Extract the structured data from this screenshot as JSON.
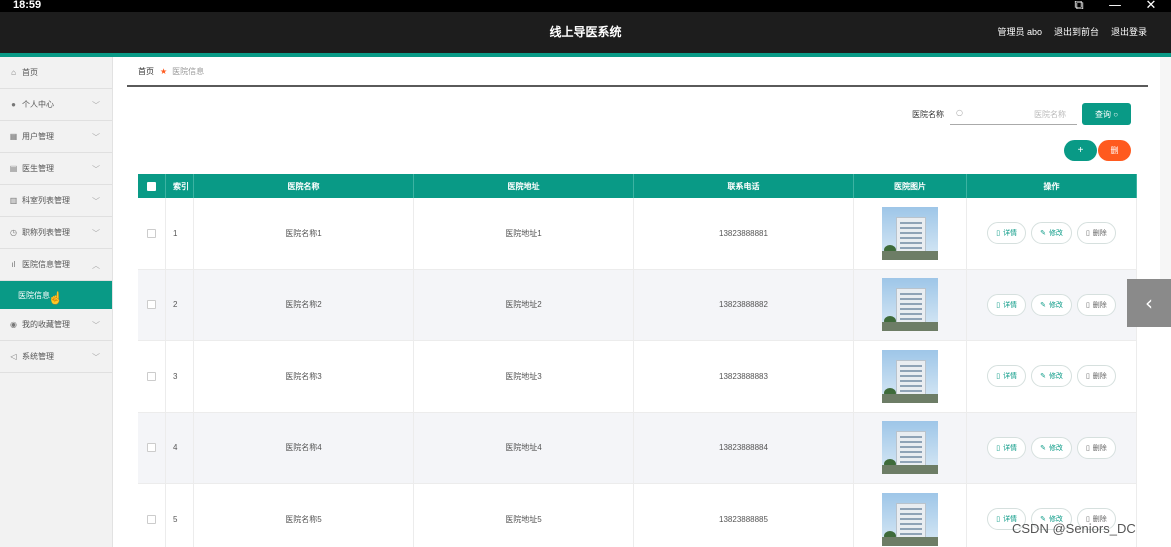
{
  "os": {
    "time": "18:59",
    "controls": [
      "⧉",
      "—",
      "✕"
    ]
  },
  "header": {
    "title": "线上导医系统",
    "admin": "管理员 abo",
    "back_front": "退出到前台",
    "logout": "退出登录"
  },
  "sidebar": {
    "items": [
      {
        "icon": "home-icon",
        "glyph": "⌂",
        "label": "首页",
        "chevron": false
      },
      {
        "icon": "user-icon",
        "glyph": "●",
        "label": "个人中心",
        "chevron": true
      },
      {
        "icon": "grid-icon",
        "glyph": "▦",
        "label": "用户管理",
        "chevron": true
      },
      {
        "icon": "building-icon",
        "glyph": "▤",
        "label": "医生管理",
        "chevron": true
      },
      {
        "icon": "bar-icon",
        "glyph": "▥",
        "label": "科室列表管理",
        "chevron": true
      },
      {
        "icon": "clock-icon",
        "glyph": "◷",
        "label": "职称列表管理",
        "chevron": true
      },
      {
        "icon": "chart-icon",
        "glyph": "ıl",
        "label": "医院信息管理",
        "chevron": true,
        "expanded": true
      }
    ],
    "sub_item": "医院信息",
    "items_after": [
      {
        "icon": "pin-icon",
        "glyph": "◉",
        "label": "我的收藏管理",
        "chevron": true
      },
      {
        "icon": "send-icon",
        "glyph": "◁",
        "label": "系统管理",
        "chevron": true
      }
    ]
  },
  "breadcrumb": {
    "home": "首页",
    "current": "医院信息"
  },
  "search": {
    "label": "医院名称",
    "placeholder": "医院名称",
    "button": "查询 ○"
  },
  "actions": {
    "add": "+",
    "delete": "删"
  },
  "table": {
    "headers": {
      "index": "索引",
      "name": "医院名称",
      "address": "医院地址",
      "phone": "联系电话",
      "picture": "医院图片",
      "ops": "操作"
    },
    "op_labels": {
      "detail": "详情",
      "edit": "修改",
      "delete": "删除"
    },
    "rows": [
      {
        "index": "1",
        "name": "医院名称1",
        "address": "医院地址1",
        "phone": "13823888881"
      },
      {
        "index": "2",
        "name": "医院名称2",
        "address": "医院地址2",
        "phone": "13823888882"
      },
      {
        "index": "3",
        "name": "医院名称3",
        "address": "医院地址3",
        "phone": "13823888883"
      },
      {
        "index": "4",
        "name": "医院名称4",
        "address": "医院地址4",
        "phone": "13823888884"
      },
      {
        "index": "5",
        "name": "医院名称5",
        "address": "医院地址5",
        "phone": "13823888885"
      }
    ]
  },
  "watermark": "CSDN @Seniors_DC",
  "colors": {
    "accent": "#099a86",
    "danger": "#ff5a1f",
    "header_bg": "#1d1d1d"
  }
}
